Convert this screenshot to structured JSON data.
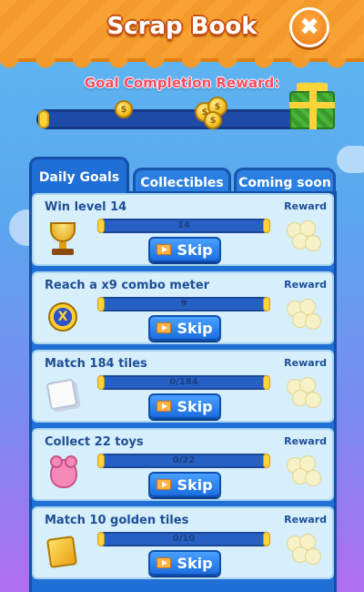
{
  "header": {
    "title": "Scrap Book",
    "close_icon": "close-icon"
  },
  "goal": {
    "label": "Goal Completion Reward:",
    "progress": 0.0
  },
  "tabs": [
    {
      "label": "Daily Goals",
      "active": true
    },
    {
      "label": "Collectibles",
      "active": false
    },
    {
      "label": "Coming soon",
      "active": false
    }
  ],
  "goals": [
    {
      "title": "Win level 14",
      "progress_text": "14",
      "progress": 0.0,
      "skip": "Skip",
      "reward": "Reward",
      "icon": "trophy-icon"
    },
    {
      "title": "Reach a x9 combo meter",
      "progress_text": "9",
      "progress": 0.0,
      "skip": "Skip",
      "reward": "Reward",
      "icon": "combo-coin-icon"
    },
    {
      "title": "Match 184 tiles",
      "progress_text": "0/184",
      "progress": 0.0,
      "skip": "Skip",
      "reward": "Reward",
      "icon": "tile-icon"
    },
    {
      "title": "Collect 22 toys",
      "progress_text": "0/22",
      "progress": 0.0,
      "skip": "Skip",
      "reward": "Reward",
      "icon": "teddy-bear-icon"
    },
    {
      "title": "Match 10 golden tiles",
      "progress_text": "0/10",
      "progress": 0.0,
      "skip": "Skip",
      "reward": "Reward",
      "icon": "golden-tile-icon"
    }
  ],
  "colors": {
    "accent": "#f39a2a",
    "panel": "#1f6fd6",
    "title_pink": "#ff4a63"
  }
}
